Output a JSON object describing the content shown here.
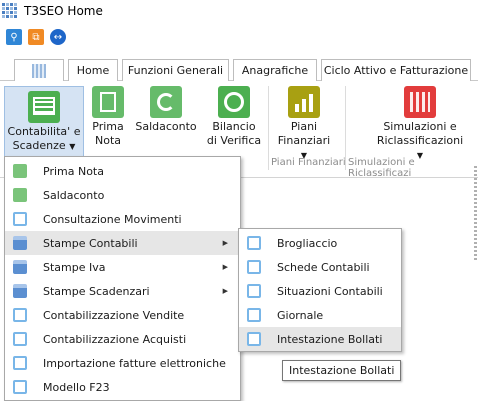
{
  "app": {
    "title": "T3SEO Home",
    "icon": "app-grid-icon"
  },
  "quickbar": {
    "items": [
      {
        "name": "key-icon",
        "color": "#2f86d6"
      },
      {
        "name": "bookmark-icon",
        "color": "#f08a24"
      },
      {
        "name": "teamviewer-icon",
        "color": "#1e66c9"
      }
    ]
  },
  "tabs": [
    {
      "label": ""
    },
    {
      "label": "Home"
    },
    {
      "label": "Funzioni Generali"
    },
    {
      "label": "Anagrafiche"
    },
    {
      "label": "Ciclo Attivo e Fatturazione"
    }
  ],
  "ribbon": {
    "buttons": [
      {
        "label1": "Contabilita' e",
        "label2": "Scadenze",
        "caret": "▼",
        "icon": "ledger-icon",
        "color": "#4caf50"
      },
      {
        "label1": "Prima",
        "label2": "Nota",
        "icon": "checklist-icon",
        "color": "#66bb6a"
      },
      {
        "label1": "Saldaconto",
        "label2": "",
        "icon": "refresh-icon",
        "color": "#66bb6a"
      },
      {
        "label1": "Bilancio",
        "label2": "di Verifica",
        "icon": "balance-icon",
        "color": "#4caf50"
      },
      {
        "label1": "Piani",
        "label2": "Finanziari",
        "caret": "▼",
        "icon": "chart-up-icon",
        "color": "#a8a012"
      },
      {
        "label1": "Simulazioni e",
        "label2": "Riclassificazioni",
        "caret": "▼",
        "icon": "grid-chart-icon",
        "color": "#e23c3c"
      }
    ],
    "groups": [
      {
        "label": "Piani Finanziari"
      },
      {
        "label": "Simulazioni e Riclassificazi"
      }
    ]
  },
  "menu": {
    "items": [
      {
        "label": "Prima Nota",
        "icon": "checklist-icon",
        "kind": "green"
      },
      {
        "label": "Saldaconto",
        "icon": "refresh-icon",
        "kind": "green"
      },
      {
        "label": "Consultazione Movimenti",
        "icon": "window-icon",
        "kind": "blueframe"
      },
      {
        "label": "Stampe Contabili",
        "icon": "printer-icon",
        "kind": "printer",
        "submenu": true,
        "highlighted": true
      },
      {
        "label": "Stampe Iva",
        "icon": "printer-icon",
        "kind": "printer",
        "submenu": true
      },
      {
        "label": "Stampe Scadenzari",
        "icon": "printer-icon",
        "kind": "printer",
        "submenu": true
      },
      {
        "label": "Contabilizzazione Vendite",
        "icon": "window-icon",
        "kind": "blueframe"
      },
      {
        "label": "Contabilizzazione Acquisti",
        "icon": "window-icon",
        "kind": "blueframe"
      },
      {
        "label": "Importazione fatture elettroniche",
        "icon": "window-icon",
        "kind": "blueframe"
      },
      {
        "label": "Modello F23",
        "icon": "window-icon",
        "kind": "blueframe"
      }
    ],
    "arrow": "▶"
  },
  "submenu": {
    "items": [
      {
        "label": "Brogliaccio",
        "icon": "window-icon"
      },
      {
        "label": "Schede Contabili",
        "icon": "window-icon"
      },
      {
        "label": "Situazioni Contabili",
        "icon": "window-icon"
      },
      {
        "label": "Giornale",
        "icon": "window-icon"
      },
      {
        "label": "Intestazione Bollati",
        "icon": "window-icon",
        "highlighted": true
      }
    ]
  },
  "tooltip": {
    "text": "Intestazione Bollati"
  }
}
